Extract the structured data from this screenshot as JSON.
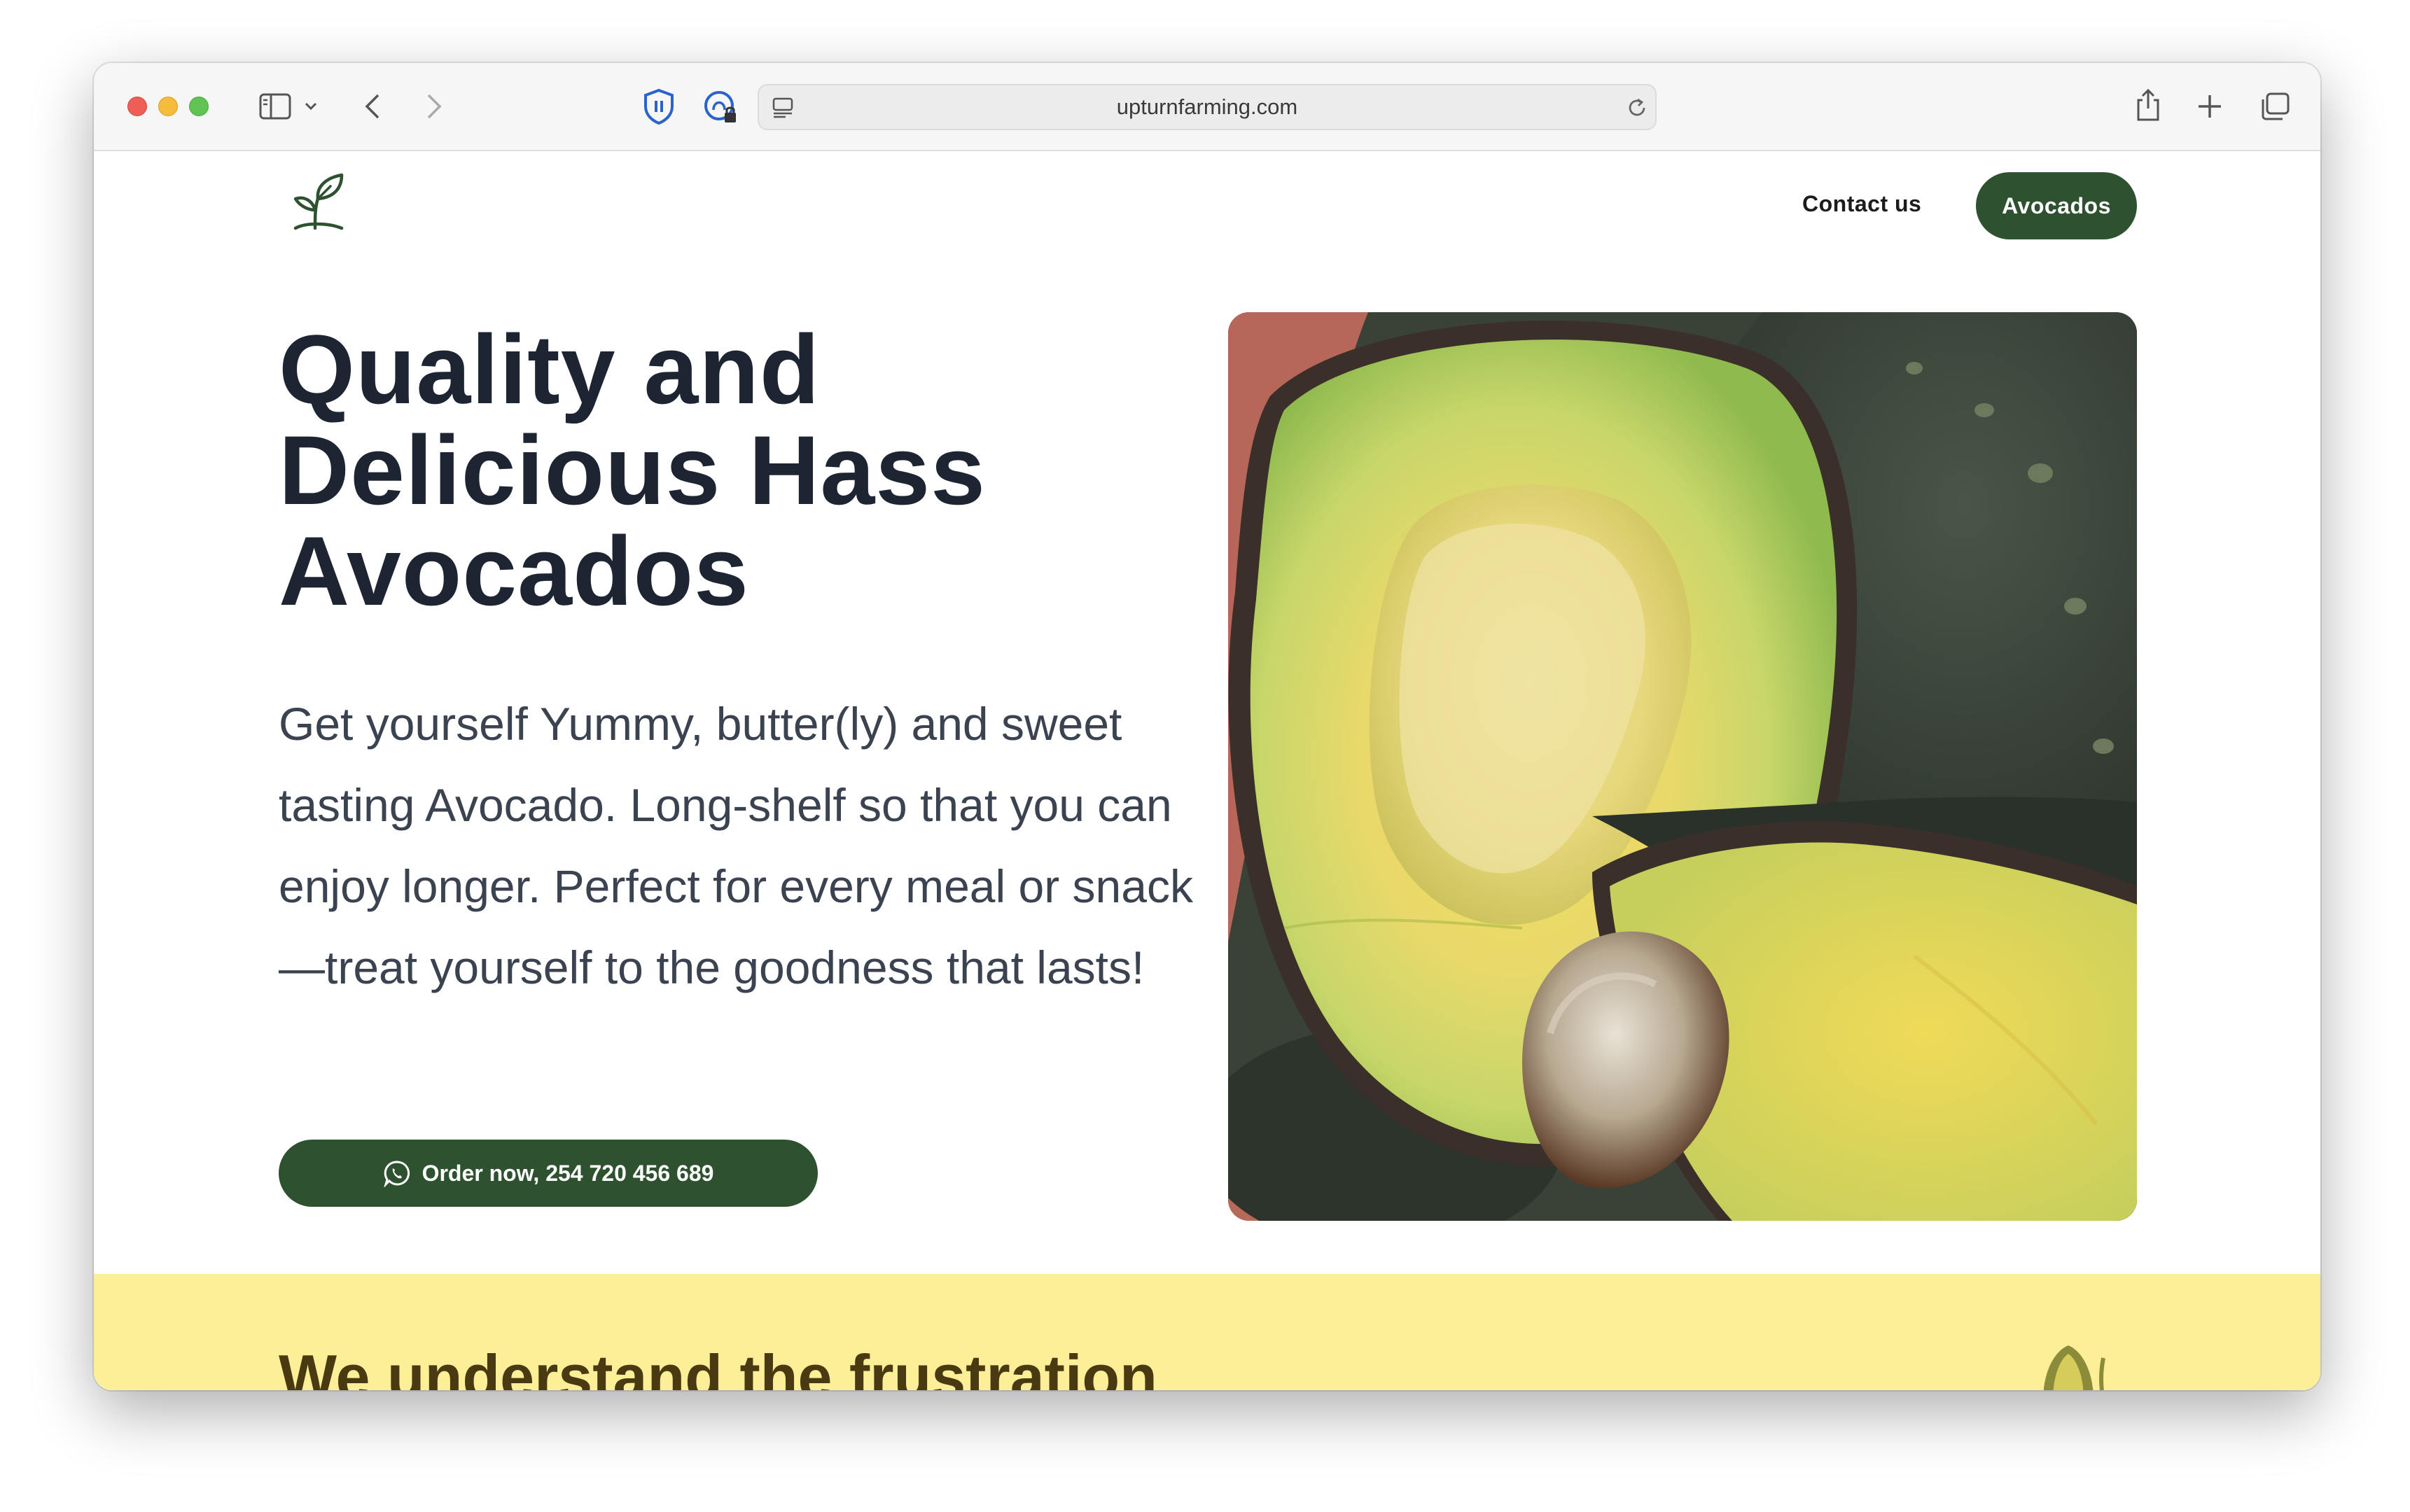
{
  "browser": {
    "url": "upturnfarming.com",
    "colors": {
      "close": "#ee5e56",
      "minimize": "#f5bd3a",
      "maximize": "#5fc454"
    },
    "icons": [
      "sidebar-icon",
      "chevron-down-icon",
      "back-icon",
      "forward-icon",
      "shield-icon",
      "privacy-report-icon",
      "reader-icon",
      "reload-icon",
      "share-icon",
      "plus-icon",
      "tabs-icon"
    ]
  },
  "nav": {
    "contact_label": "Contact us",
    "avocados_label": "Avocados"
  },
  "hero": {
    "title_lines": [
      "Quality and",
      "Delicious Hass",
      "Avocados"
    ],
    "description": "Get yourself Yummy, butter(ly) and sweet tasting Avocado. Long-shelf so that you can enjoy longer. Perfect for every meal or snack—treat yourself to the goodness that lasts!",
    "order_button": "Order now, 254 720 456 689",
    "image_subject": "halved Hass avocado"
  },
  "section": {
    "title": "We understand the frustration"
  },
  "theme": {
    "brand_green": "#2e5230",
    "heading_color": "#1d2533",
    "band_yellow": "#fdef98"
  }
}
